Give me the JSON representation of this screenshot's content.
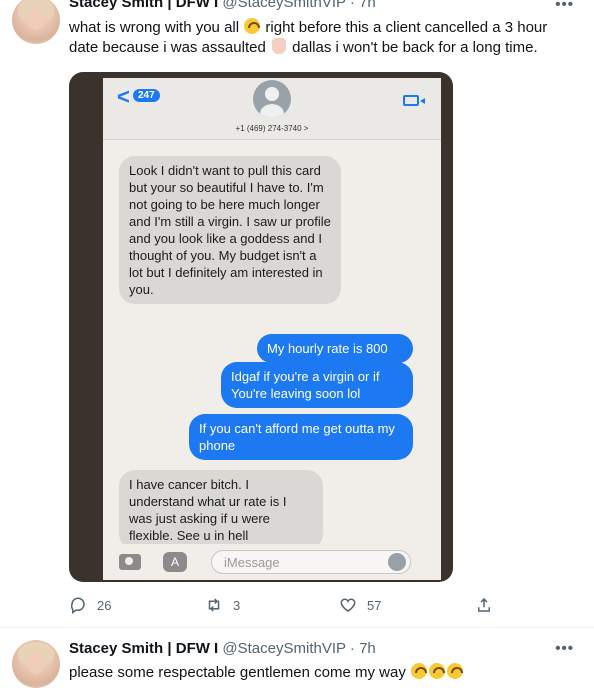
{
  "tweets": [
    {
      "author_name": "Stacey Smith | DFW I",
      "handle": "@StaceySmithVIP",
      "separator": "·",
      "time": "7h",
      "more": "•••",
      "text_part1": "what is wrong with you all",
      "text_part2": "right before this a client cancelled a 3 hour date because i was assaulted",
      "text_part3": "dallas i won't be back for a long time.",
      "media": {
        "back_label": "<",
        "badge_count": "247",
        "contact_number": "+1 (469) 274-3740 >",
        "messages": [
          {
            "from": "them",
            "text": "Look I didn't want to pull this card but your so beautiful I have to. I'm not going to be here much longer and I'm still a virgin. I saw ur profile and you look like a goddess and I thought of you. My budget isn't a lot but I definitely am interested in you."
          },
          {
            "from": "me",
            "text": "My hourly rate is 800"
          },
          {
            "from": "me",
            "text": "Idgaf if you're a virgin or if You're leaving soon lol"
          },
          {
            "from": "me",
            "text": "If you can't afford me get outta my phone"
          },
          {
            "from": "them",
            "text": "I have cancer bitch. I understand what ur rate is I was just asking if u were flexible. See u in hell"
          }
        ],
        "input_placeholder": "iMessage",
        "apps_glyph": "A"
      },
      "actions": {
        "reply_count": "26",
        "retweet_count": "3",
        "like_count": "57"
      }
    },
    {
      "author_name": "Stacey Smith | DFW I",
      "handle": "@StaceySmithVIP",
      "separator": "·",
      "time": "7h",
      "more": "•••",
      "text": "please some respectable gentlemen come my way"
    }
  ]
}
